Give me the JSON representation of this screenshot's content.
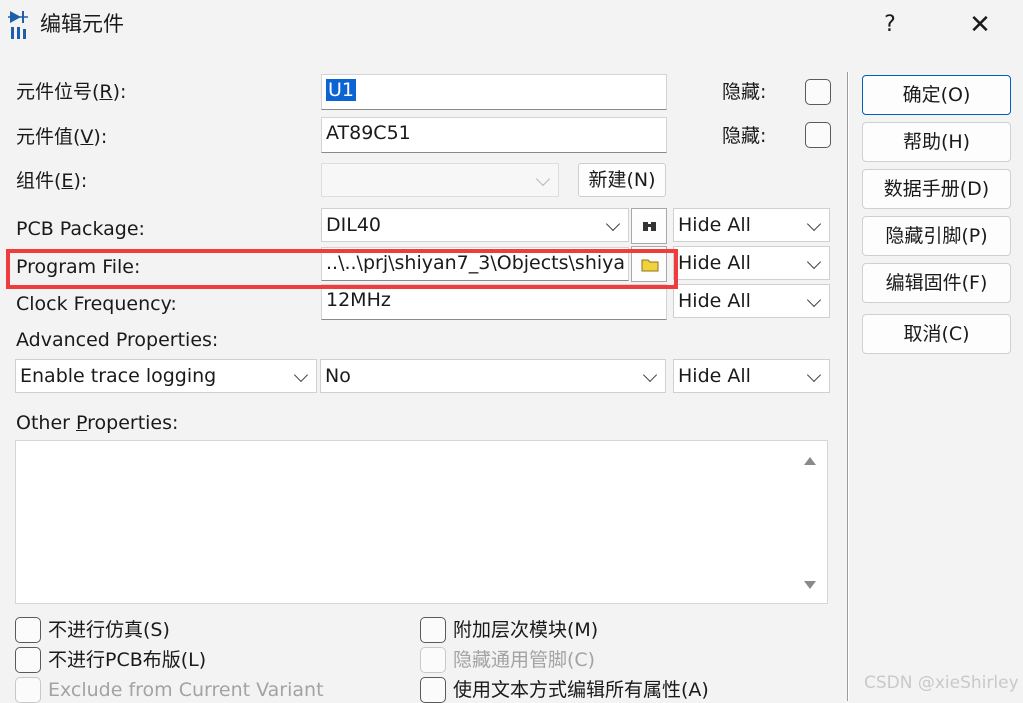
{
  "window": {
    "title": "编辑元件",
    "help": "?",
    "close": "✕"
  },
  "form": {
    "ref_label_pre": "元件位号(",
    "ref_label_key": "R",
    "ref_label_post": "):",
    "ref_value": "U1",
    "value_label_pre": "元件值(",
    "value_label_key": "V",
    "value_label_post": "):",
    "value_value": "AT89C51",
    "hidden_label": "隐藏:",
    "group_label_pre": "组件(",
    "group_label_key": "E",
    "group_label_post": "):",
    "group_value": "",
    "new_button": "新建(N)",
    "pcb_label": "PCB Package:",
    "pcb_value": "DIL40",
    "program_label": "Program File:",
    "program_value": "..\\..\\prj\\shiyan7_3\\Objects\\shiya",
    "clock_label": "Clock Frequency:",
    "clock_value": "12MHz",
    "advanced_label": "Advanced Properties:",
    "advanced_property": "Enable trace logging",
    "advanced_value": "No",
    "hide_all": "Hide All",
    "other_label_pre": "Other ",
    "other_label_key": "P",
    "other_label_post": "roperties:",
    "other_value": ""
  },
  "checkboxes": {
    "no_sim": "不进行仿真(S)",
    "no_pcb": "不进行PCB布版(L)",
    "exclude_variant": "Exclude from Current Variant",
    "attach_hier": "附加层次模块(M)",
    "hide_pins": "隐藏通用管脚(C)",
    "edit_text": "使用文本方式编辑所有属性(A)"
  },
  "buttons": {
    "ok": "确定(O)",
    "help": "帮助(H)",
    "datasheet": "数据手册(D)",
    "hidden_pins": "隐藏引脚(P)",
    "firmware": "编辑固件(F)",
    "cancel": "取消(C)"
  },
  "watermark": "CSDN @xieShirley",
  "colors": {
    "highlight": "#0a64d4",
    "annotation": "#f03c3c",
    "default_button_border": "#005fb8"
  }
}
